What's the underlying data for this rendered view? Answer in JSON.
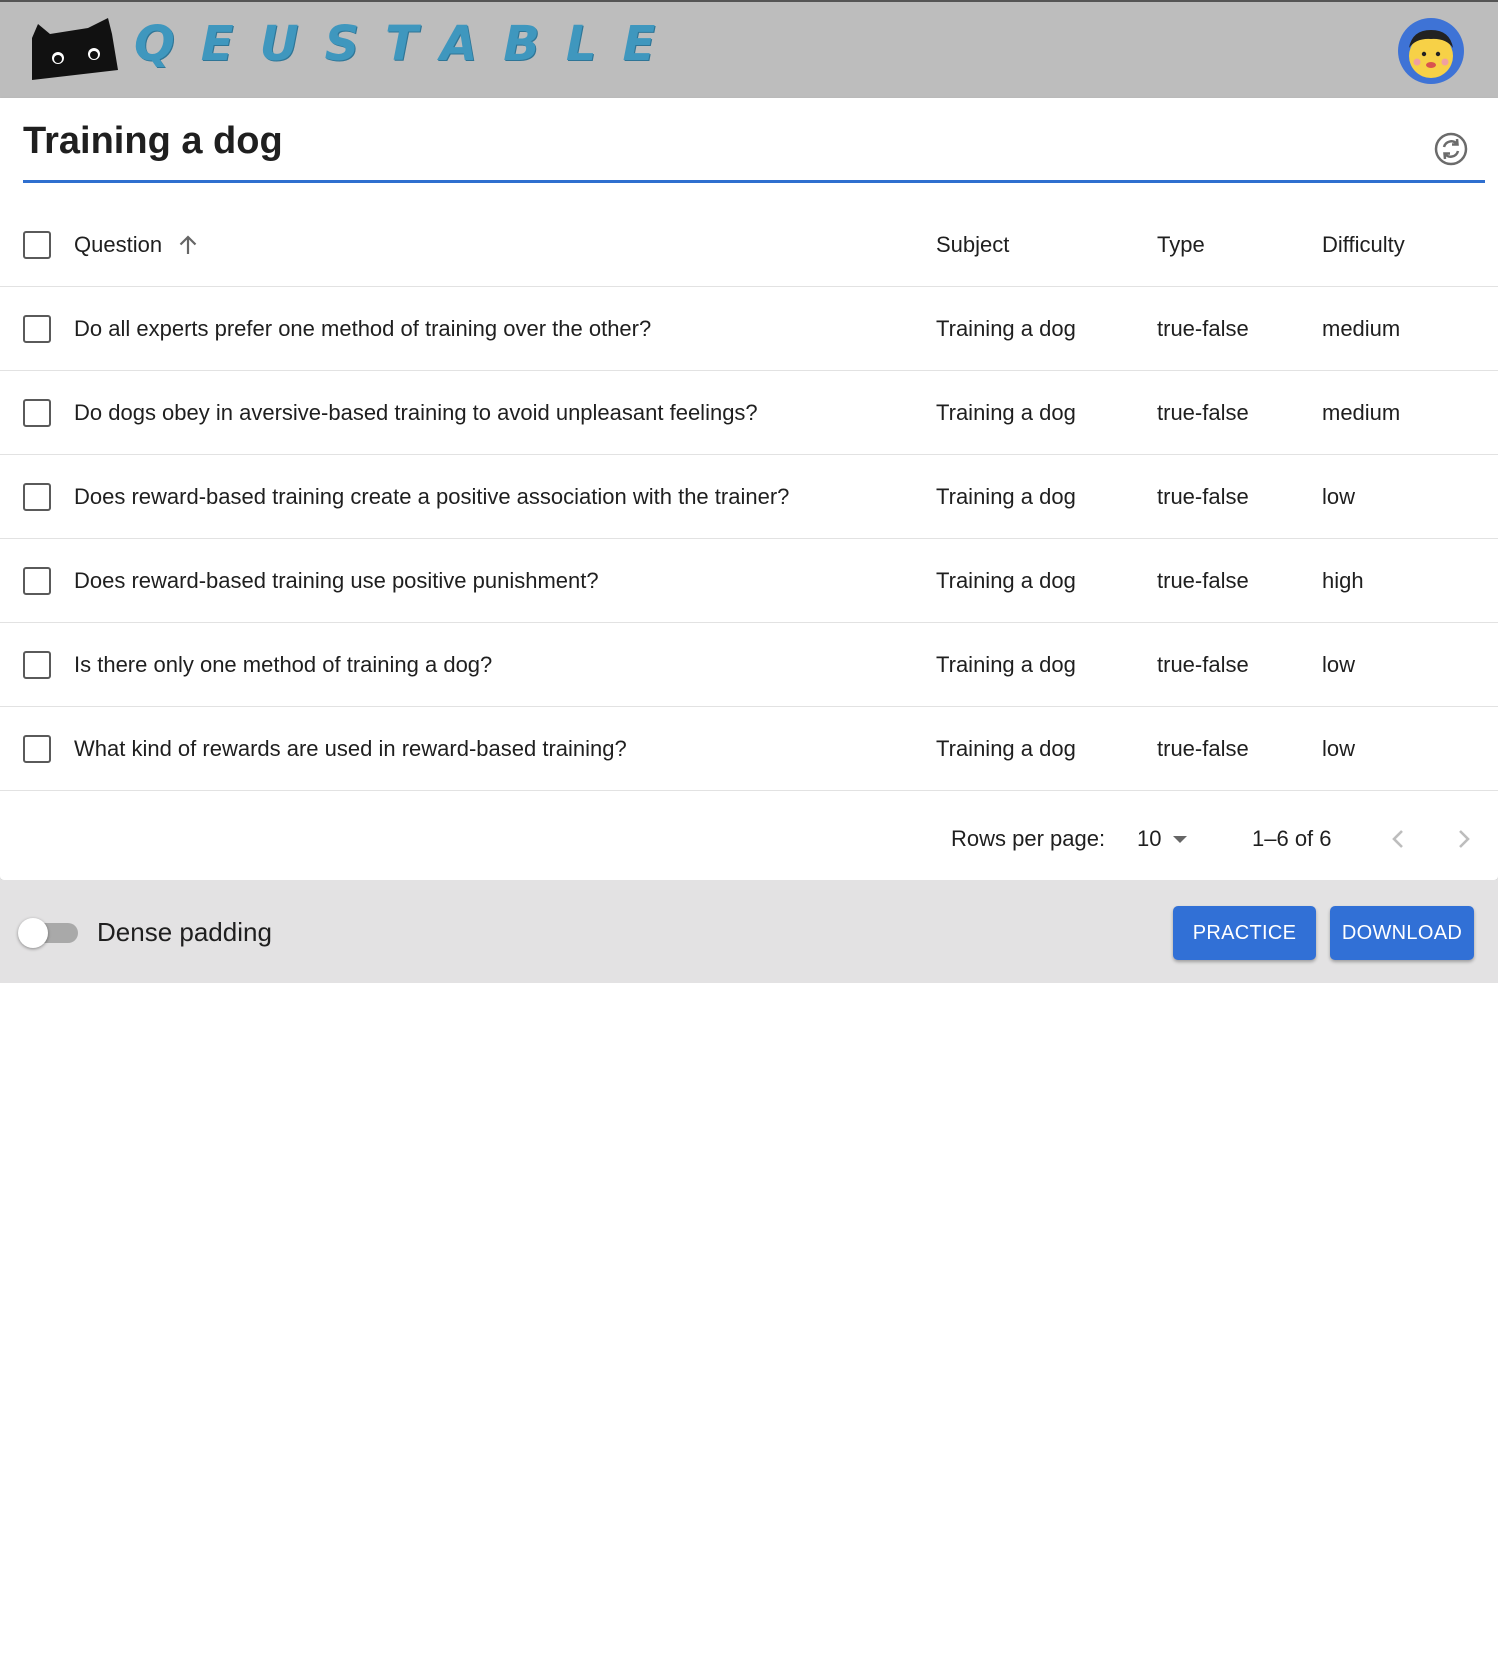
{
  "header": {
    "logo_text": "QEUSTABLE",
    "logo_icon": "cat-icon",
    "avatar_icon": "user-avatar-icon",
    "background": "#bdbdbd",
    "logo_color": "#3f97be"
  },
  "page": {
    "title": "Training a dog",
    "refresh_icon": "refresh-icon",
    "accent": "#2f6fcf"
  },
  "table": {
    "columns": [
      "Question",
      "Subject",
      "Type",
      "Difficulty"
    ],
    "sort": {
      "column": "Question",
      "direction": "ascending"
    },
    "rows": [
      {
        "question": "Do all experts prefer one method of training over the other?",
        "subject": "Training a dog",
        "type": "true-false",
        "difficulty": "medium",
        "selected": false
      },
      {
        "question": "Do dogs obey in aversive-based training to avoid unpleasant feelings?",
        "subject": "Training a dog",
        "type": "true-false",
        "difficulty": "medium",
        "selected": false
      },
      {
        "question": "Does reward-based training create a positive association with the trainer?",
        "subject": "Training a dog",
        "type": "true-false",
        "difficulty": "low",
        "selected": false
      },
      {
        "question": "Does reward-based training use positive punishment?",
        "subject": "Training a dog",
        "type": "true-false",
        "difficulty": "high",
        "selected": false
      },
      {
        "question": "Is there only one method of training a dog?",
        "subject": "Training a dog",
        "type": "true-false",
        "difficulty": "low",
        "selected": false
      },
      {
        "question": "What kind of rewards are used in reward-based training?",
        "subject": "Training a dog",
        "type": "true-false",
        "difficulty": "low",
        "selected": false
      }
    ]
  },
  "pagination": {
    "rows_per_page_label": "Rows per page:",
    "rows_per_page_value": "10",
    "range_text": "1–6 of 6"
  },
  "footer": {
    "dense_padding_label": "Dense padding",
    "dense_padding_on": false,
    "practice_label": "PRACTICE",
    "download_label": "DOWNLOAD",
    "button_color": "#3170d6"
  }
}
